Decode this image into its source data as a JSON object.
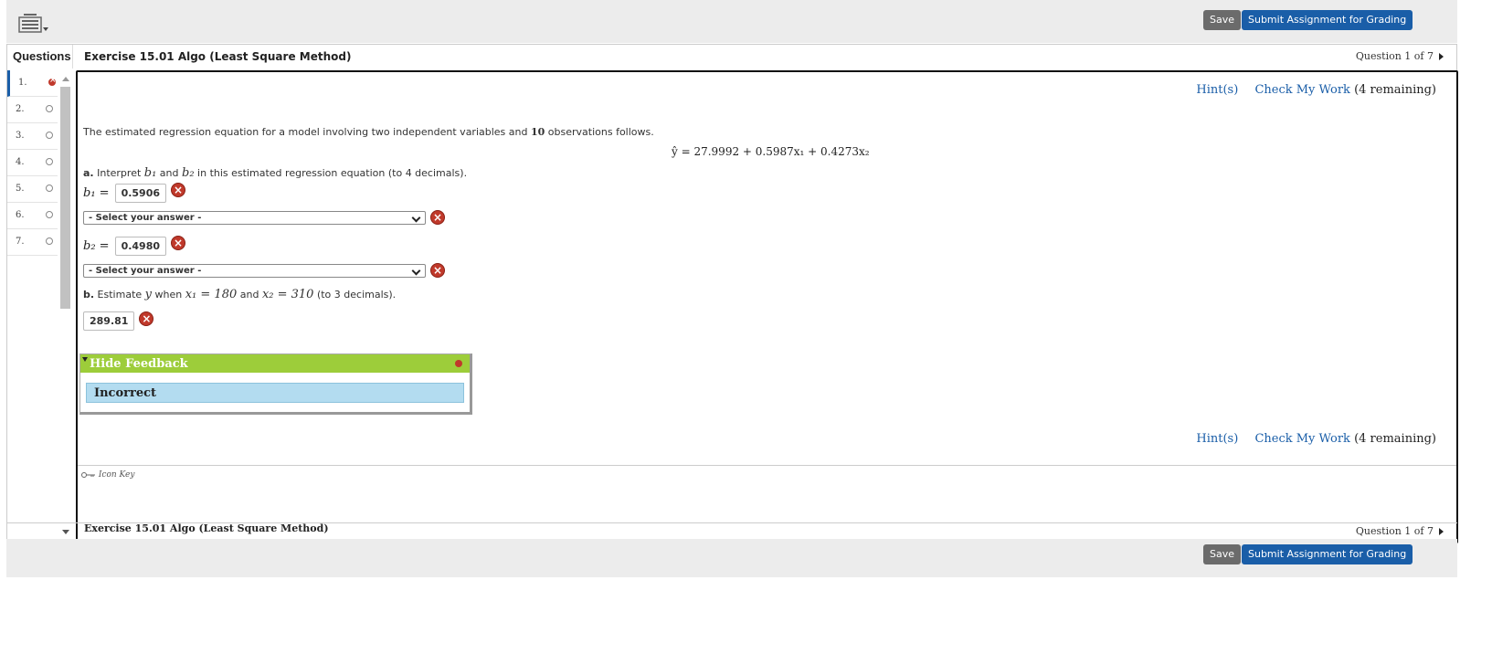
{
  "toolbar": {
    "save_label": "Save",
    "submit_label": "Submit Assignment for Grading"
  },
  "questions_header": "Questions",
  "exercise_title": "Exercise 15.01 Algo (Least Square Method)",
  "question_counter": "Question 1 of 7",
  "questions": [
    {
      "num": "1.",
      "status": "incorrect"
    },
    {
      "num": "2.",
      "status": "unanswered"
    },
    {
      "num": "3.",
      "status": "unanswered"
    },
    {
      "num": "4.",
      "status": "unanswered"
    },
    {
      "num": "5.",
      "status": "unanswered"
    },
    {
      "num": "6.",
      "status": "unanswered"
    },
    {
      "num": "7.",
      "status": "unanswered"
    }
  ],
  "hints": {
    "hint_label": "Hint(s)",
    "check_label": "Check My Work",
    "remaining": "(4 remaining)"
  },
  "stem": {
    "prefix": "The estimated regression equation for a model involving two independent variables and ",
    "n": "10",
    "suffix": " observations follows."
  },
  "equation": "ŷ = 27.9992 + 0.5987x₁ + 0.4273x₂",
  "part_a": {
    "label": "a.",
    "text_pre": " Interpret ",
    "b1": "b₁",
    "mid": " and ",
    "b2": "b₂",
    "text_post": " in this estimated regression equation (to 4 decimals)."
  },
  "answers": {
    "b1_label": "b₁ =",
    "b1_value": "0.5906",
    "b2_label": "b₂ =",
    "b2_value": "0.4980",
    "select_placeholder": "- Select your answer -"
  },
  "part_b": {
    "label": "b.",
    "text_pre": " Estimate ",
    "y": "y",
    "when": " when ",
    "x1": "x₁ = 180",
    "and": " and ",
    "x2": "x₂ = 310",
    "post": " (to 3 decimals).",
    "value": "289.81"
  },
  "feedback": {
    "header": "Hide Feedback",
    "result": "Incorrect"
  },
  "icon_key": "Icon Key",
  "colors": {
    "accent": "#1a5ea8",
    "feedback_green": "#9dcd3a",
    "incorrect_red": "#c0392b"
  }
}
